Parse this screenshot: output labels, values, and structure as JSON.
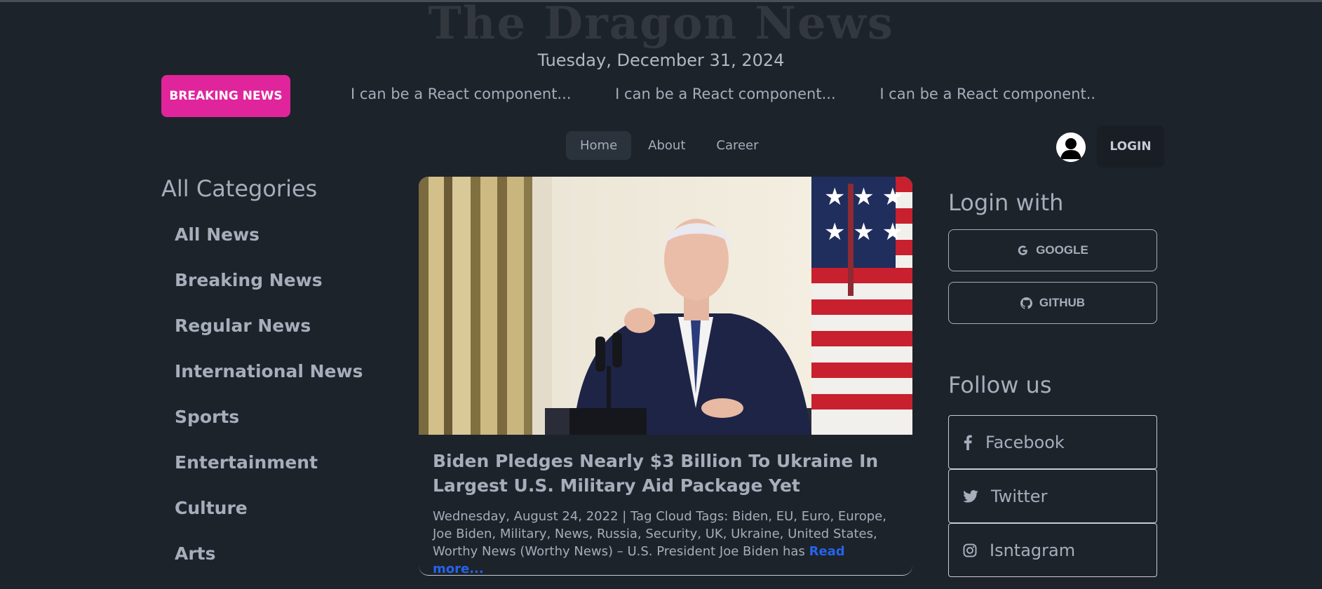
{
  "header": {
    "logo": "The Dragon News",
    "date": "Tuesday, December 31, 2024"
  },
  "ticker": {
    "badge": "BREAKING NEWS",
    "items": [
      "I can be a React component...",
      "I can be a React component...",
      "I can be a React component..."
    ]
  },
  "nav": {
    "links": [
      "Home",
      "About",
      "Career"
    ],
    "active": "Home",
    "login_label": "LOGIN"
  },
  "categories": {
    "title": "All Categories",
    "items": [
      "All News",
      "Breaking News",
      "Regular News",
      "International News",
      "Sports",
      "Entertainment",
      "Culture",
      "Arts"
    ]
  },
  "article": {
    "title": "Biden Pledges Nearly $3 Billion To Ukraine In Largest U.S. Military Aid Package Yet",
    "description": "Wednesday, August 24, 2022 | Tag Cloud Tags: Biden, EU, Euro, Europe, Joe Biden, Military, News, Russia, Security, UK, Ukraine, United States, Worthy News (Worthy News) – U.S. President Joe Biden has ",
    "read_more": "Read more..."
  },
  "login_with": {
    "title": "Login with",
    "google": "GOOGLE",
    "github": "GITHUB"
  },
  "follow_us": {
    "title": "Follow us",
    "facebook": "Facebook",
    "twitter": "Twitter",
    "instagram": "Isntagram"
  },
  "colors": {
    "background": "#1d232a",
    "breaking_badge": "#e0259c",
    "read_more": "#2563eb"
  }
}
